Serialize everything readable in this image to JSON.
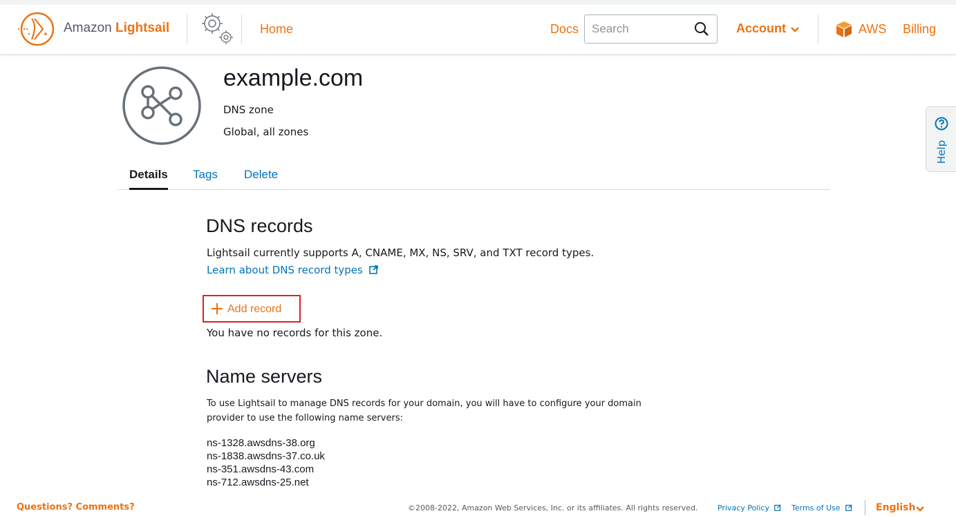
{
  "header": {
    "brand_prefix": "Amazon",
    "brand_name": "Lightsail",
    "home": "Home",
    "docs": "Docs",
    "search_placeholder": "Search",
    "account": "Account",
    "aws": "AWS",
    "billing": "Billing"
  },
  "resource": {
    "title": "example.com",
    "type": "DNS zone",
    "region": "Global, all zones"
  },
  "help": {
    "label": "Help"
  },
  "tabs": [
    {
      "label": "Details",
      "active": true
    },
    {
      "label": "Tags",
      "active": false
    },
    {
      "label": "Delete",
      "active": false
    }
  ],
  "dns_records": {
    "heading": "DNS records",
    "description": "Lightsail currently supports A, CNAME, MX, NS, SRV, and TXT record types.",
    "learn_link": "Learn about DNS record types",
    "add_record": "Add record",
    "empty_message": "You have no records for this zone."
  },
  "name_servers": {
    "heading": "Name servers",
    "description": "To use Lightsail to manage DNS records for your domain, you will have to configure your domain provider to use the following name servers:",
    "servers": [
      "ns-1328.awsdns-38.org",
      "ns-1838.awsdns-37.co.uk",
      "ns-351.awsdns-43.com",
      "ns-712.awsdns-25.net"
    ]
  },
  "footer": {
    "questions": "Questions? Comments?",
    "copyright": "©2008-2022, Amazon Web Services, Inc. or its affiliates. All rights reserved.",
    "privacy": "Privacy Policy",
    "terms": "Terms of Use",
    "language": "English"
  },
  "colors": {
    "accent": "#ec7211",
    "link": "#0073bb",
    "highlight_border": "#e02020",
    "text": "#16191f"
  }
}
